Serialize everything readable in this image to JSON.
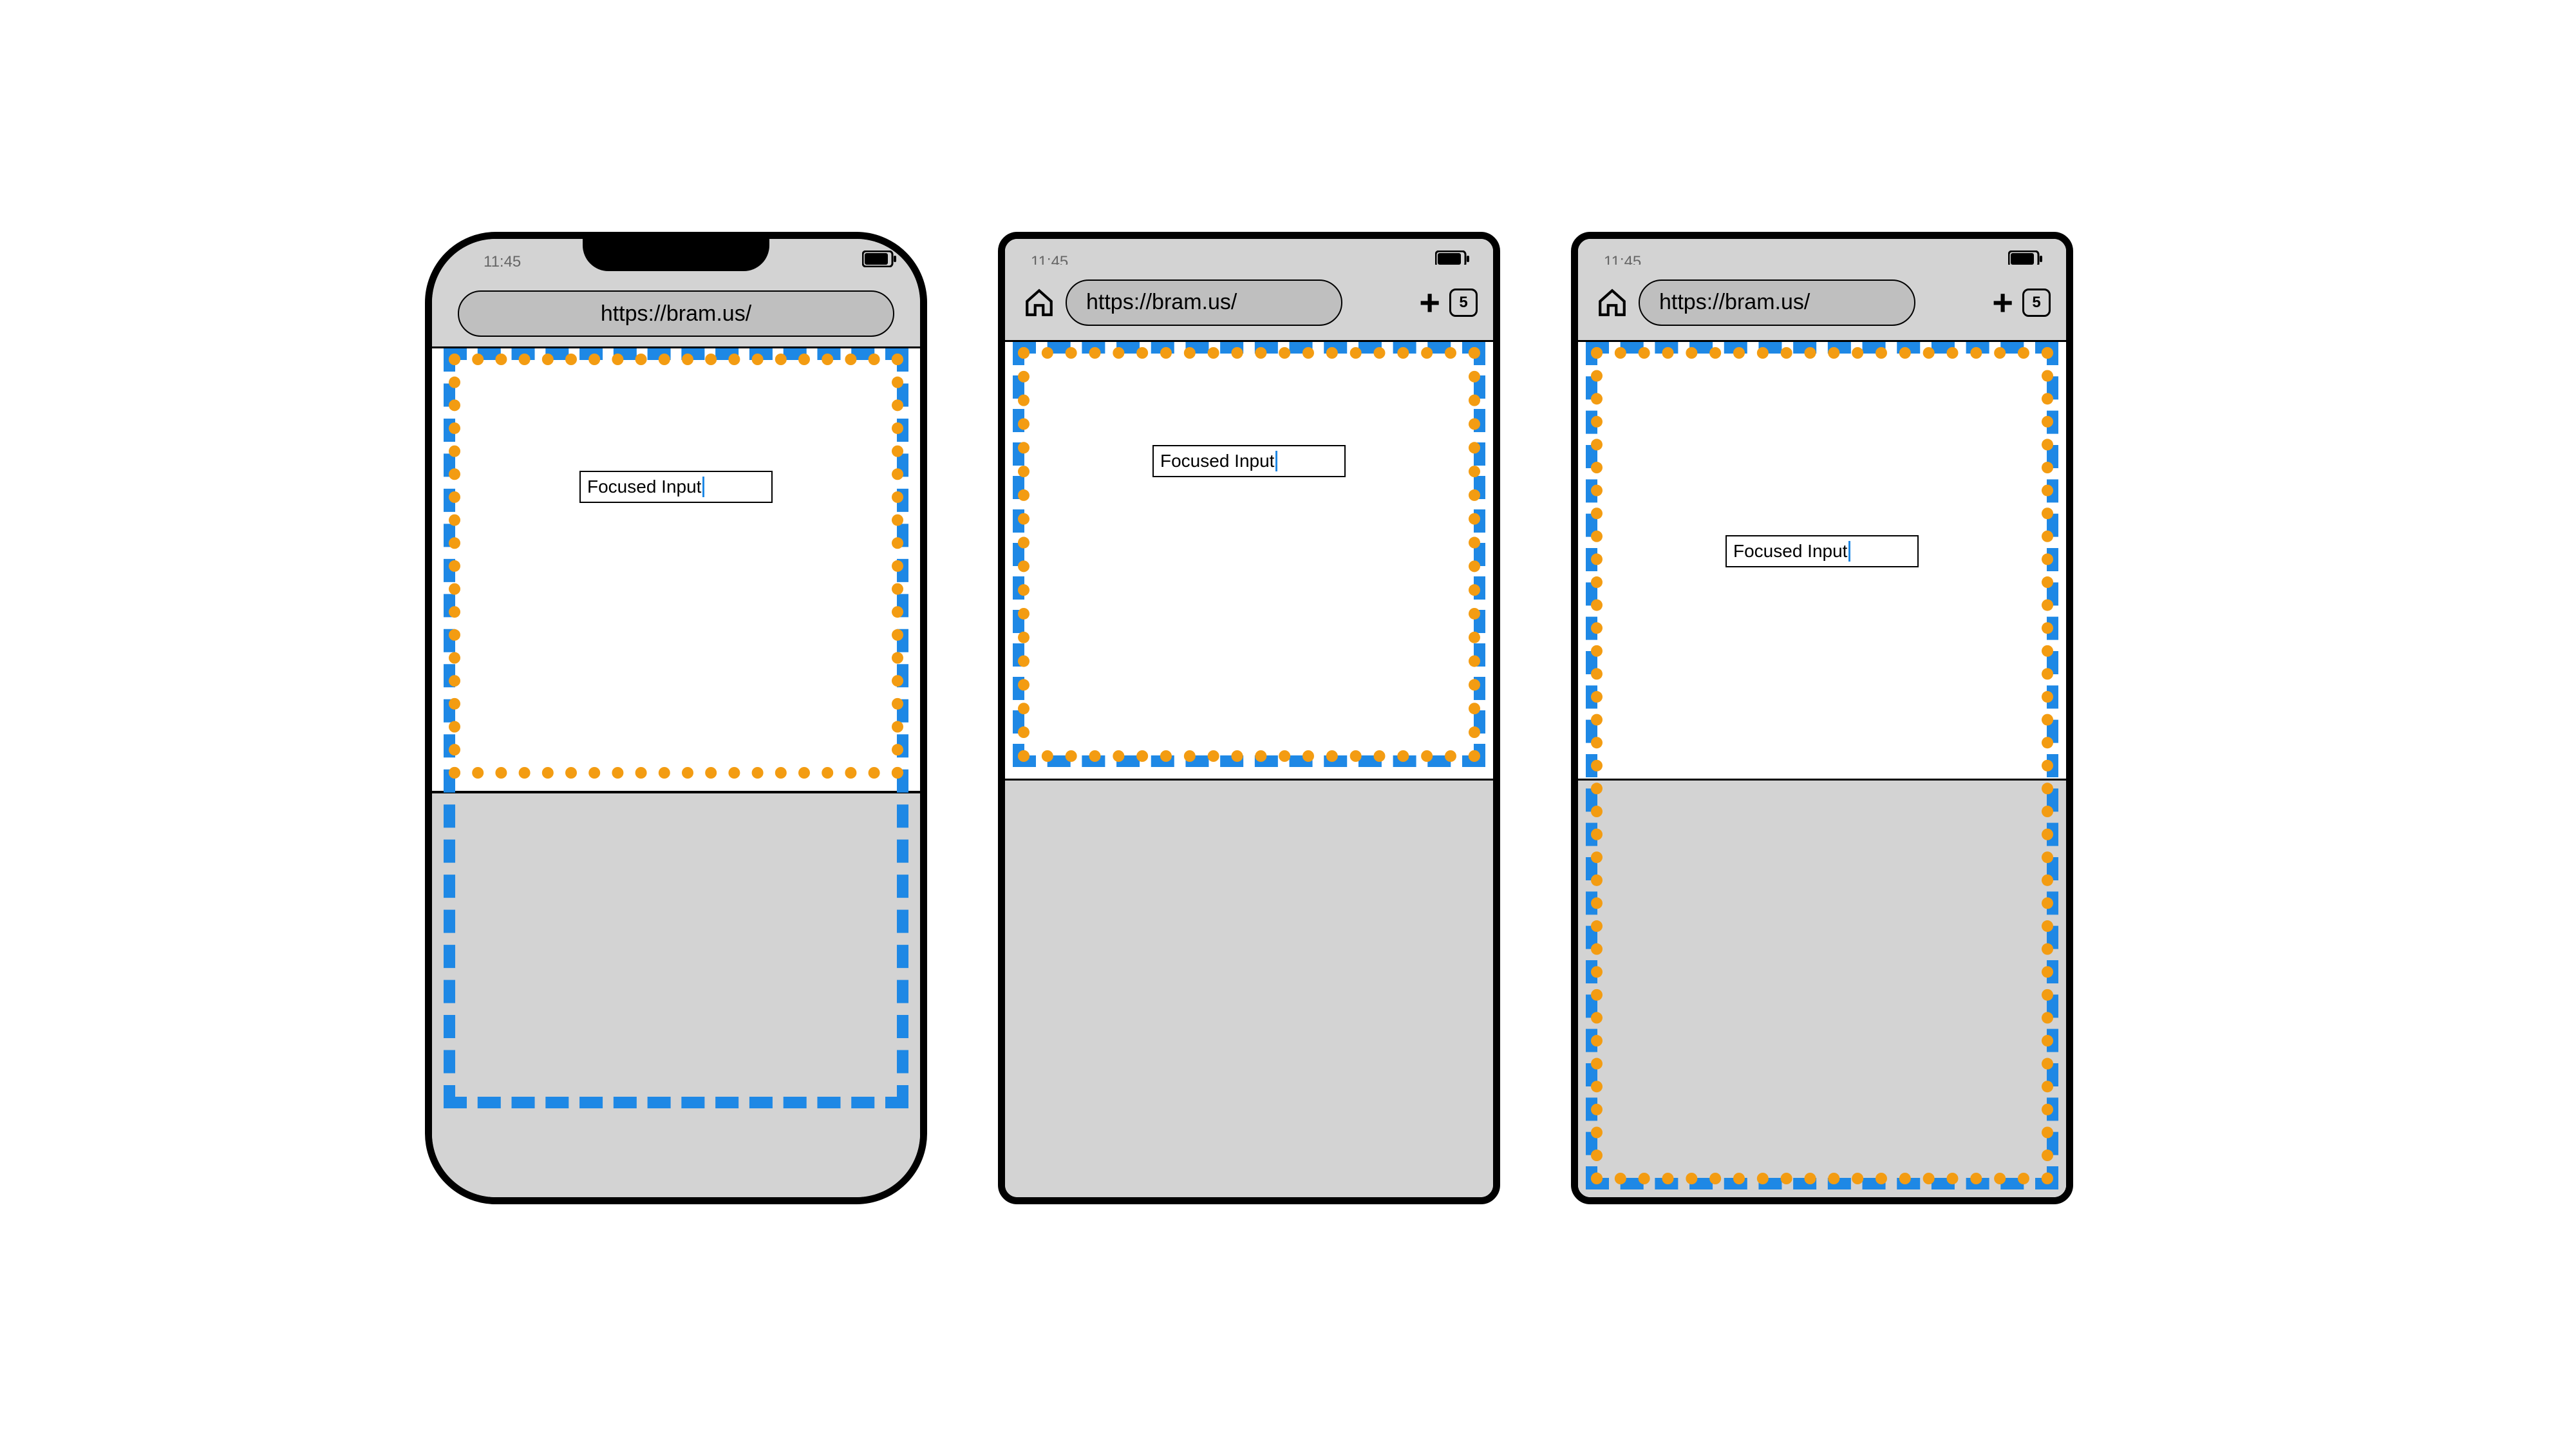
{
  "status": {
    "time": "11:45"
  },
  "addr": {
    "url": "https://bram.us/",
    "tabs": "5"
  },
  "input": {
    "value": "Focused Input"
  }
}
